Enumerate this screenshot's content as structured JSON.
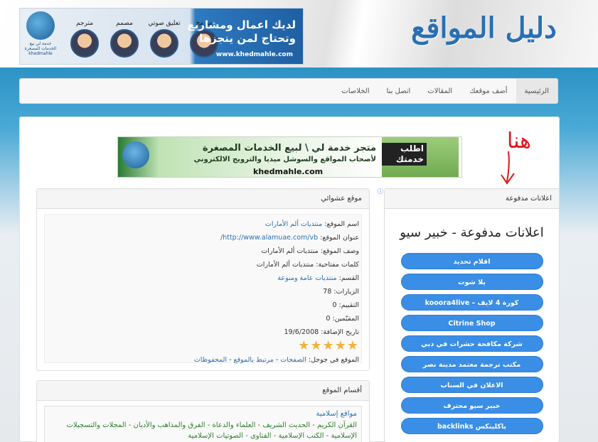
{
  "header": {
    "site_title": "دليل المواقع",
    "banner": {
      "headline": "لديك اعمال ومشاريع وتحتاج لمن ينجزها",
      "url": "www.khedmahle.com",
      "logo_caption": "خدمة لي بيع الخدمات المصغرة khedmahle",
      "roles": [
        "مبرمج",
        "تعليق صوتي",
        "مصمم",
        "مترجم"
      ]
    }
  },
  "nav": {
    "items": [
      "الرئيسية",
      "أضف موقعك",
      "المقالات",
      "اتصل بنا",
      "الخلاصات"
    ],
    "active_index": 0
  },
  "ad_banner": {
    "line1": "متجر خدمة لي \\ لبيع الخدمات المصغرة",
    "line2": "لأصحاب المواقع والسوشل ميديا والترويج الالكتروني",
    "url": "khedmahle.com",
    "cta": "اطلب خدمتك"
  },
  "paid_ads": {
    "header": "اعلانات مدفوعة",
    "title": "اعلانات مدفوعة - خبير سيو",
    "links": [
      "اقلام تحديد",
      "يلا شوت",
      "كورة 4 لايف – kooora4live",
      "Citrine Shop",
      "شركة مكافحة حشرات في دبي",
      "مكتب ترجمة معتمد مدينة نصر",
      "الاعلان في السناب",
      "خبير سيو محترف",
      "باكلينكس backlinks"
    ]
  },
  "random_site": {
    "header": "موقع عشوائي",
    "rows": [
      {
        "label": "اسم الموقع:",
        "value": "منتديات ألم الأمارات",
        "link": true
      },
      {
        "label": "عنوان الموقع:",
        "value": "http://www.alamuae.com/vb/",
        "link": true
      },
      {
        "label": "وصف الموقع:",
        "value": "منتديات ألم الأمارات",
        "link": false
      },
      {
        "label": "كلمات مفتاحية:",
        "value": "منتديات ألم الأمارات",
        "link": false
      },
      {
        "label": "القسم:",
        "value": "منتديات عامة ومنوعة",
        "link": true
      },
      {
        "label": "الزيارات:",
        "value": "78",
        "link": false
      },
      {
        "label": "التقييم:",
        "value": "0",
        "link": false
      },
      {
        "label": "المقيّمين:",
        "value": "0",
        "link": false
      },
      {
        "label": "تاريخ الإضافة:",
        "value": "19/6/2008",
        "link": false
      }
    ],
    "rating_stars": 5,
    "footer_label": "الموقع في جوجل:",
    "footer_links": [
      "الصفحات",
      "مرتبط بالموقع",
      "المحفوظات"
    ]
  },
  "categories": {
    "header": "أقسام الموقع",
    "title": "مواقع إسلامية",
    "desc": "القرآن الكريم - الحديث الشريف - العلماء والدعاة - الفرق والمذاهب والأديان - المجلات والتسجيلات الإسلامية - الكتب الإسلامية - الفتاوى - الصوتيات الإسلامية"
  },
  "annotation": {
    "handwritten": "هنا"
  },
  "colors": {
    "accent": "#2a6fb3",
    "button": "#3a8ee6",
    "header_band": "#2b93c4",
    "annotation": "#e0161b"
  }
}
